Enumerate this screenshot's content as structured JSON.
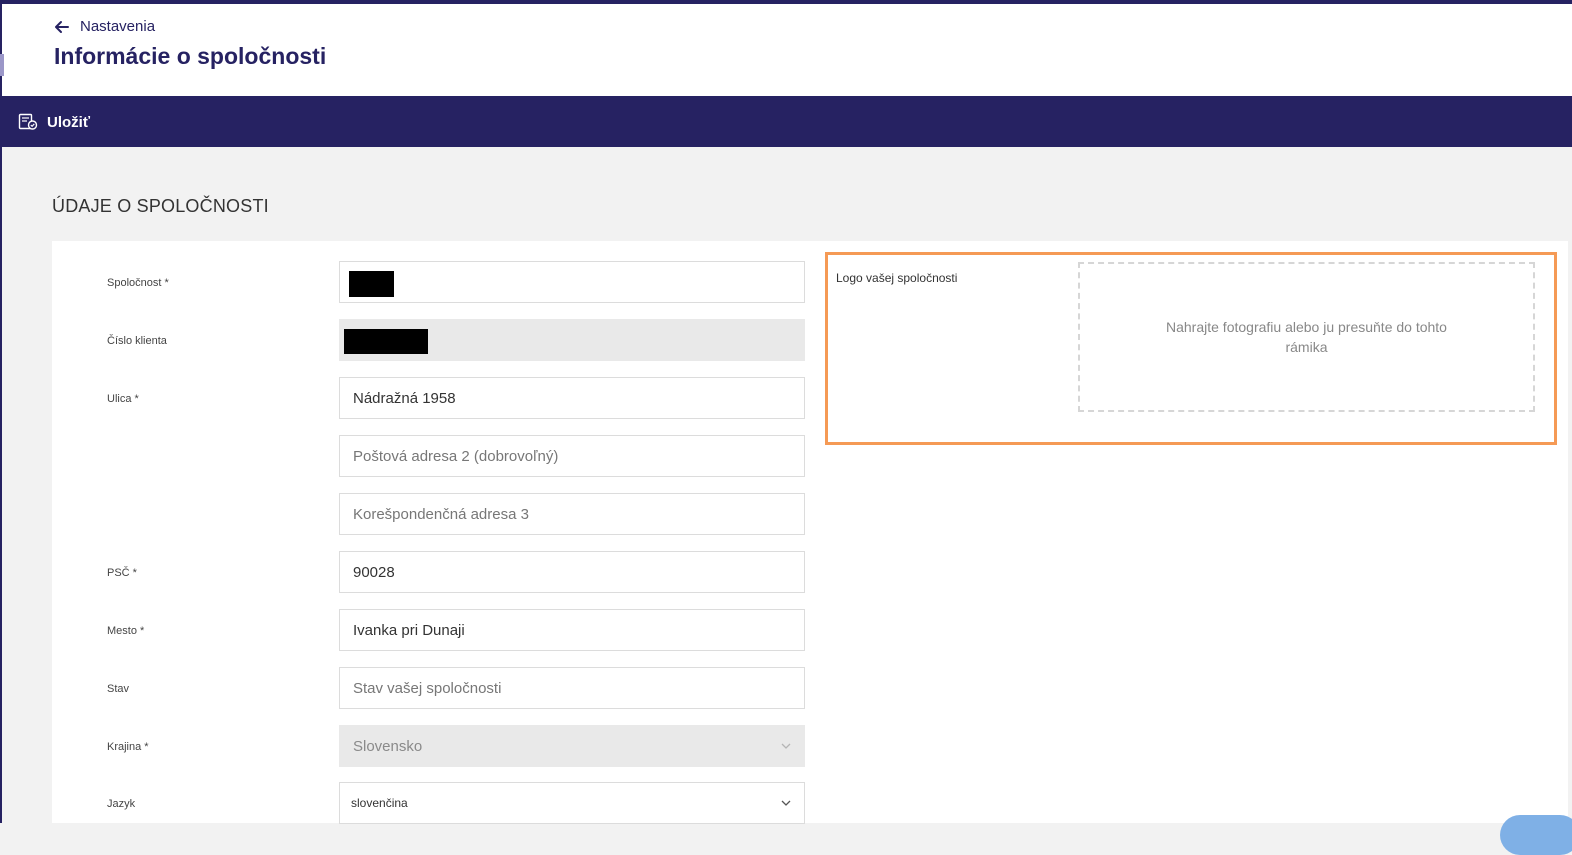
{
  "header": {
    "back_label": "Nastavenia",
    "title": "Informácie o spoločnosti"
  },
  "toolbar": {
    "save_label": "Uložiť"
  },
  "section": {
    "title": "ÚDAJE O SPOLOČNOSTI"
  },
  "form": {
    "company_label": "Spoločnost *",
    "client_number_label": "Číslo klienta",
    "street_label": "Ulica *",
    "street_value": "Nádražná 1958",
    "address2_placeholder": "Poštová adresa 2 (dobrovoľný)",
    "address3_placeholder": "Korešpondenčná adresa 3",
    "zip_label": "PSČ *",
    "zip_value": "90028",
    "city_label": "Mesto *",
    "city_value": "Ivanka pri Dunaji",
    "state_label": "Stav",
    "state_placeholder": "Stav vašej spoločnosti",
    "country_label": "Krajina *",
    "country_value": "Slovensko",
    "language_label": "Jazyk",
    "language_value": "slovenčina"
  },
  "logo": {
    "label": "Logo vašej spoločnosti",
    "dropzone_text": "Nahrajte fotografiu alebo ju presuňte do tohto rámika"
  },
  "colors": {
    "brand": "#262262",
    "highlight": "#f59a55"
  }
}
